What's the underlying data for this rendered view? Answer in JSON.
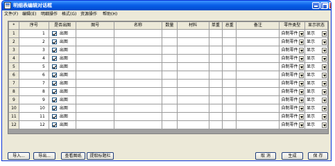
{
  "window": {
    "title": "明细表编辑对话框"
  },
  "menu": [
    "文件(F)",
    "编辑(E)",
    "明细操作",
    "格式(G)",
    "资源操作",
    "帮助(H)"
  ],
  "table": {
    "headers": [
      "*",
      "序号",
      "是否出图",
      "图号",
      "名称",
      "数量",
      "材料",
      "单重",
      "总重",
      "备注",
      "零件类型",
      "显示状态"
    ],
    "rows": [
      {
        "row": "1",
        "seq": "1",
        "out": "出图",
        "type": "自制零件",
        "show": "显示"
      },
      {
        "row": "2",
        "seq": "2",
        "out": "出图",
        "type": "自制零件",
        "show": "显示"
      },
      {
        "row": "3",
        "seq": "3",
        "out": "出图",
        "type": "自制零件",
        "show": "显示"
      },
      {
        "row": "4",
        "seq": "4",
        "out": "出图",
        "type": "自制零件",
        "show": "显示"
      },
      {
        "row": "5",
        "seq": "5",
        "out": "出图",
        "type": "自制零件",
        "show": "显示"
      },
      {
        "row": "6",
        "seq": "6",
        "out": "出图",
        "type": "自制零件",
        "show": "显示"
      },
      {
        "row": "7",
        "seq": "7",
        "out": "出图",
        "type": "自制零件",
        "show": "显示"
      },
      {
        "row": "8",
        "seq": "8",
        "out": "出图",
        "type": "自制零件",
        "show": "显示"
      },
      {
        "row": "9",
        "seq": "9",
        "out": "出图",
        "type": "自制零件",
        "show": "显示"
      },
      {
        "row": "10",
        "seq": "10",
        "out": "出图",
        "type": "自制零件",
        "show": "显示"
      },
      {
        "row": "11",
        "seq": "11",
        "out": "出图",
        "type": "自制零件",
        "show": "显示"
      },
      {
        "row": "12",
        "seq": "12",
        "out": "出图",
        "type": "自制零件",
        "show": "显示"
      }
    ]
  },
  "buttons": {
    "import": "导入...",
    "export": "导出...",
    "view_drawing": "查看图纸",
    "extract_title": "提取标题栏",
    "cancel": "取 消",
    "generate": "生成",
    "save": "保 存"
  },
  "icons": {
    "app": "app-icon",
    "minimize": "minimize-icon",
    "maximize": "maximize-icon",
    "close": "close-icon"
  }
}
